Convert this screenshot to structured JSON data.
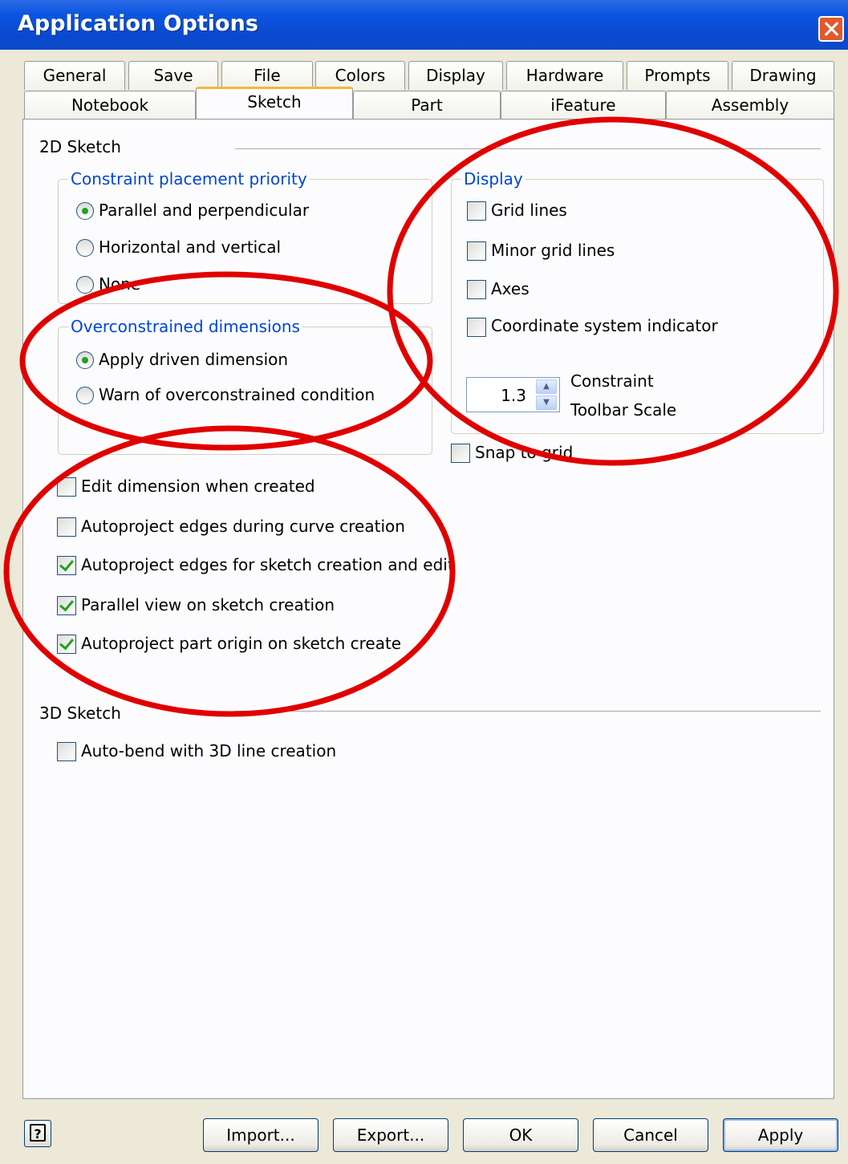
{
  "window": {
    "title": "Application Options"
  },
  "tabs_row1": [
    "General",
    "Save",
    "File",
    "Colors",
    "Display",
    "Hardware",
    "Prompts",
    "Drawing"
  ],
  "tabs_row2": [
    "Notebook",
    "Sketch",
    "Part",
    "iFeature",
    "Assembly"
  ],
  "active_tab": "Sketch",
  "sketch2d": {
    "label": "2D Sketch",
    "constraint_group": {
      "title": "Constraint placement priority",
      "options": [
        "Parallel and perpendicular",
        "Horizontal and vertical",
        "None"
      ],
      "selected": "Parallel and perpendicular"
    },
    "overconstrained_group": {
      "title": "Overconstrained dimensions",
      "options": [
        "Apply driven dimension",
        "Warn of overconstrained condition"
      ],
      "selected": "Apply driven dimension"
    },
    "display_group": {
      "title": "Display",
      "grid_lines": "Grid lines",
      "minor_grid_lines": "Minor grid lines",
      "axes": "Axes",
      "coord_indicator": "Coordinate system indicator",
      "scale_value": "1.3",
      "scale_label_1": "Constraint",
      "scale_label_2": "Toolbar Scale"
    },
    "snap_to_grid": "Snap to grid",
    "checks": [
      {
        "label": "Edit dimension when created",
        "checked": false
      },
      {
        "label": "Autoproject edges during curve creation",
        "checked": false
      },
      {
        "label": "Autoproject edges for sketch creation and edit",
        "checked": true
      },
      {
        "label": "Parallel view on sketch creation",
        "checked": true
      },
      {
        "label": "Autoproject part origin on sketch create",
        "checked": true
      }
    ]
  },
  "sketch3d": {
    "label": "3D Sketch",
    "auto_bend": "Auto-bend with 3D line creation"
  },
  "buttons": {
    "import": "Import...",
    "export": "Export...",
    "ok": "OK",
    "cancel": "Cancel",
    "apply": "Apply"
  },
  "colors": {
    "title_bar": "#0a49cf",
    "group_title": "#0046d5",
    "annotation": "#e00000",
    "check_mark": "#21a121"
  }
}
